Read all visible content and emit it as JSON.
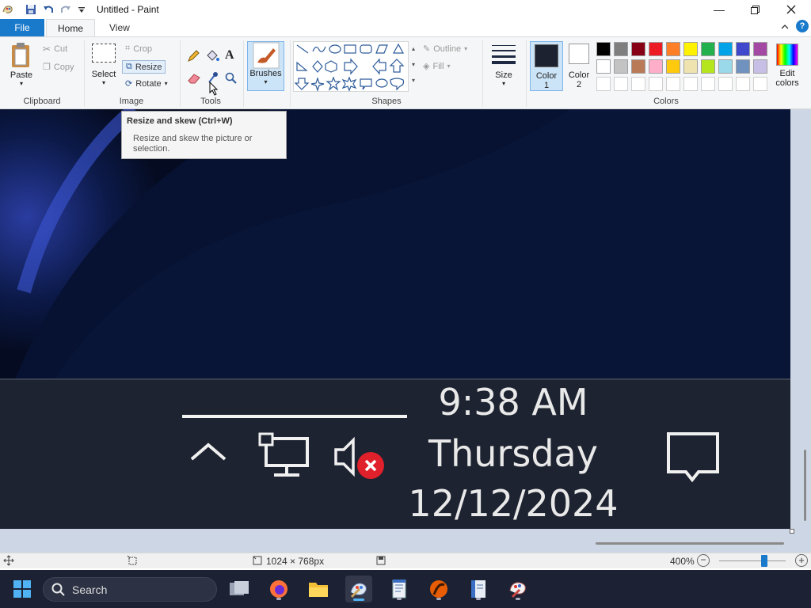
{
  "window": {
    "title": "Untitled - Paint"
  },
  "tabs": [
    {
      "label": "File"
    },
    {
      "label": "Home"
    },
    {
      "label": "View"
    }
  ],
  "clipboard": {
    "paste": "Paste",
    "cut": "Cut",
    "copy": "Copy",
    "group": "Clipboard"
  },
  "image": {
    "select": "Select",
    "crop": "Crop",
    "resize": "Resize",
    "rotate": "Rotate",
    "group": "Image"
  },
  "tools": {
    "group": "Tools"
  },
  "brushes": {
    "label": "Brushes"
  },
  "shapes": {
    "outline": "Outline",
    "fill": "Fill",
    "group": "Shapes"
  },
  "size": {
    "label": "Size"
  },
  "color1": {
    "label": "Color",
    "num": "1"
  },
  "color2": {
    "label": "Color",
    "num": "2"
  },
  "colors": {
    "group": "Colors",
    "edit_label": "Edit",
    "edit_label2": "colors",
    "row1": [
      "#000000",
      "#7f7f7f",
      "#880015",
      "#ed1c24",
      "#ff7f27",
      "#fff200",
      "#22b14c",
      "#00a2e8",
      "#3f48cc",
      "#a349a4"
    ],
    "row2": [
      "#ffffff",
      "#c3c3c3",
      "#b97a57",
      "#ffaec9",
      "#ffc90e",
      "#efe4b0",
      "#b5e61d",
      "#99d9ea",
      "#7092be",
      "#c8bfe7"
    ],
    "row3": [
      "#ffffff",
      "#ffffff",
      "#ffffff",
      "#ffffff",
      "#ffffff",
      "#ffffff",
      "#ffffff",
      "#ffffff",
      "#ffffff",
      "#ffffff"
    ],
    "color1_value": "#1c2230",
    "color2_value": "#ffffff"
  },
  "tooltip": {
    "title": "Resize and skew (Ctrl+W)",
    "body": "Resize and skew the picture or selection."
  },
  "canvas": {
    "time": "9:38 AM",
    "day": "Thursday",
    "date": "12/12/2024"
  },
  "status": {
    "dimensions": "1024 × 768px",
    "zoom": "400%"
  },
  "taskbar": {
    "search_placeholder": "Search"
  }
}
